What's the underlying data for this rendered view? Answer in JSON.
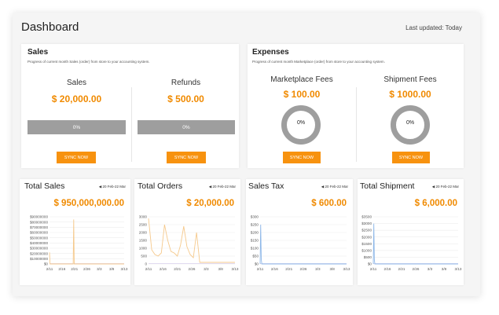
{
  "header": {
    "title": "Dashboard",
    "last_updated": "Last updated: Today"
  },
  "sales": {
    "title": "Sales",
    "subtitle": "Progress of current month Sales (order) from store to your accounting system.",
    "columns": [
      {
        "label": "Sales",
        "value": "$ 20,000.00",
        "progress": "0%",
        "progress_value": 0,
        "button": "SYNC NOW"
      },
      {
        "label": "Refunds",
        "value": "$ 500.00",
        "progress": "0%",
        "progress_value": 0,
        "button": "SYNC NOW"
      }
    ]
  },
  "expenses": {
    "title": "Expenses",
    "subtitle": "Progress of current month Marketplace (order) from store to your accounting system.",
    "columns": [
      {
        "label": "Marketplace Fees",
        "value": "$ 100.00",
        "progress": "0%",
        "progress_value": 0,
        "button": "SYNC NOW"
      },
      {
        "label": "Shipment Fees",
        "value": "$ 1000.00",
        "progress": "0%",
        "progress_value": 0,
        "button": "SYNC NOW"
      }
    ]
  },
  "colors": {
    "accent": "#f08a00",
    "button": "#f7920f",
    "progress": "#9e9e9e",
    "line_orange": "#f5c98c",
    "line_blue": "#8db7e8",
    "baseline": "#d9d0ee"
  },
  "date_icon": "chevron-left-icon",
  "chart_data": [
    {
      "type": "line",
      "title": "Total Sales",
      "value": "$ 950,000,000.00",
      "date_range": "20 Feb-22 Mar",
      "x": [
        "2/11",
        "2/16",
        "2/21",
        "2/26",
        "3/3",
        "3/8",
        "3/13"
      ],
      "y_ticks": [
        "$0",
        "$10000000",
        "$20000000",
        "$30000000",
        "$40000000",
        "$50000000",
        "$60000000",
        "$70000000",
        "$80000000",
        "$90000000"
      ],
      "ylim": [
        0,
        90000000
      ],
      "color": "#f5c98c",
      "series": [
        {
          "values": [
            22000000,
            0,
            0,
            0,
            0,
            0,
            0,
            0,
            0,
            0,
            0,
            0,
            0,
            0,
            0,
            0,
            0,
            0,
            0,
            0,
            0,
            0,
            0,
            0,
            0,
            0,
            0,
            0,
            0,
            0,
            0,
            0,
            0,
            0,
            0,
            0,
            0,
            0,
            0,
            0,
            0,
            0,
            0,
            0,
            0,
            0,
            0,
            85000000,
            0,
            0,
            0,
            0,
            0,
            0,
            0,
            0,
            0,
            0,
            0,
            0,
            0,
            0,
            0,
            0,
            0,
            0,
            0,
            0,
            0,
            0,
            0,
            0,
            0,
            0,
            0,
            0,
            0,
            0,
            0,
            0,
            0,
            0,
            0,
            0,
            0,
            0,
            0,
            0,
            0,
            0,
            0,
            0,
            0,
            0,
            0,
            0,
            0,
            0,
            0,
            0,
            0,
            0,
            0,
            0,
            0,
            0,
            0,
            0,
            0,
            0,
            0,
            0,
            0,
            0,
            0,
            0,
            0,
            0,
            0,
            0,
            0,
            0,
            0,
            0,
            0,
            0,
            0,
            0,
            0,
            0,
            0,
            0,
            0,
            0,
            0,
            0,
            0,
            0,
            0,
            0,
            0,
            0,
            0,
            0,
            0,
            0
          ]
        }
      ],
      "grid": true
    },
    {
      "type": "line",
      "title": "Total Orders",
      "value": "$ 20,000.00",
      "date_range": "20 Feb-22 Mar",
      "x": [
        "2/11",
        "2/16",
        "2/21",
        "2/26",
        "3/3",
        "3/8",
        "3/13"
      ],
      "y_ticks": [
        "0",
        "500",
        "1000",
        "1500",
        "2000",
        "2500",
        "3000"
      ],
      "ylim": [
        0,
        3000
      ],
      "color": "#f5c98c",
      "series": [
        {
          "values": [
            2900,
            900,
            600,
            500,
            700,
            2500,
            1500,
            800,
            700,
            500,
            1200,
            2400,
            1100,
            600,
            400,
            2000,
            100,
            100,
            100,
            100,
            100,
            100,
            100,
            100,
            100,
            100,
            100,
            100
          ]
        }
      ],
      "grid": true
    },
    {
      "type": "line",
      "title": "Sales Tax",
      "value": "$ 600.00",
      "date_range": "20 Feb-22 Mar",
      "x": [
        "2/11",
        "2/16",
        "2/21",
        "2/26",
        "3/3",
        "3/8",
        "3/13"
      ],
      "y_ticks": [
        "$0",
        "$50",
        "$100",
        "$150",
        "$200",
        "$250",
        "$300"
      ],
      "ylim": [
        0,
        300
      ],
      "color": "#8db7e8",
      "series": [
        {
          "values": [
            0,
            250,
            30,
            0,
            0,
            0,
            0,
            0,
            0,
            0,
            0,
            0,
            0,
            0,
            0,
            0,
            0,
            0,
            0,
            0,
            0,
            0,
            0,
            0,
            0,
            0,
            0,
            0,
            0,
            0,
            0,
            0,
            0,
            0,
            0,
            0,
            0,
            0,
            0,
            0,
            0,
            0,
            0,
            0,
            0,
            0,
            0,
            0,
            0,
            0,
            0,
            0,
            0,
            0,
            0,
            0,
            0,
            0,
            0,
            0,
            0,
            0,
            0,
            0,
            0,
            0,
            0,
            0,
            0,
            0,
            0,
            0,
            0,
            0,
            0,
            0,
            0,
            0,
            0,
            0,
            0,
            0,
            0,
            0,
            0,
            0,
            0,
            0,
            0,
            0,
            0,
            0,
            0,
            0,
            0,
            0,
            0,
            0,
            0,
            0,
            0,
            0,
            0,
            0,
            0,
            0,
            0,
            0,
            0,
            0,
            0,
            0,
            0,
            0,
            0,
            0,
            0,
            0,
            0,
            0,
            0,
            0,
            0,
            0,
            0,
            0,
            0,
            0,
            0,
            0,
            0,
            0,
            0,
            0,
            0,
            0,
            0,
            0,
            0,
            0,
            0,
            0,
            0,
            0,
            0,
            0,
            0,
            0,
            0,
            0,
            0
          ]
        }
      ],
      "grid": true
    },
    {
      "type": "line",
      "title": "Total Shipment",
      "value": "$ 6,000.00",
      "date_range": "20 Feb-22 Mar",
      "x": [
        "2/11",
        "2/16",
        "2/21",
        "2/26",
        "3/3",
        "3/8",
        "3/13"
      ],
      "y_ticks": [
        "$0",
        "$500",
        "$1000",
        "$1500",
        "$2000",
        "$2500",
        "$3000",
        "$3500"
      ],
      "ylim": [
        0,
        3500
      ],
      "color": "#8db7e8",
      "series": [
        {
          "values": [
            0,
            3000,
            300,
            0,
            0,
            0,
            0,
            0,
            0,
            0,
            0,
            0,
            0,
            0,
            0,
            0,
            0,
            0,
            0,
            0,
            0,
            0,
            0,
            0,
            0,
            0,
            0,
            0,
            0,
            0,
            0,
            0,
            0,
            0,
            0,
            0,
            0,
            0,
            0,
            0,
            0,
            0,
            0,
            0,
            0,
            0,
            0,
            0,
            0,
            0,
            0,
            0,
            0,
            0,
            0,
            0,
            0,
            0,
            0,
            0,
            0,
            0,
            0,
            0,
            0,
            0,
            0,
            0,
            0,
            0,
            0,
            0,
            0,
            0,
            0,
            0,
            0,
            0,
            0,
            0,
            0,
            0,
            0,
            0,
            0,
            0,
            0,
            0,
            0,
            0,
            0,
            0,
            0,
            0,
            0,
            0,
            0,
            0,
            0,
            0,
            0,
            0,
            0,
            0,
            0,
            0,
            0,
            0,
            0,
            0,
            0,
            0,
            0,
            0,
            0,
            0,
            0,
            0,
            0,
            0,
            0,
            0,
            0,
            0,
            0,
            0,
            0,
            0,
            0,
            0,
            0,
            0,
            0,
            0,
            0,
            0,
            0,
            0,
            0,
            0,
            0,
            0,
            0,
            0,
            0,
            0,
            0,
            0,
            0,
            0,
            0,
            0,
            0,
            0,
            0,
            0,
            0,
            0,
            0
          ]
        }
      ],
      "grid": true
    }
  ]
}
